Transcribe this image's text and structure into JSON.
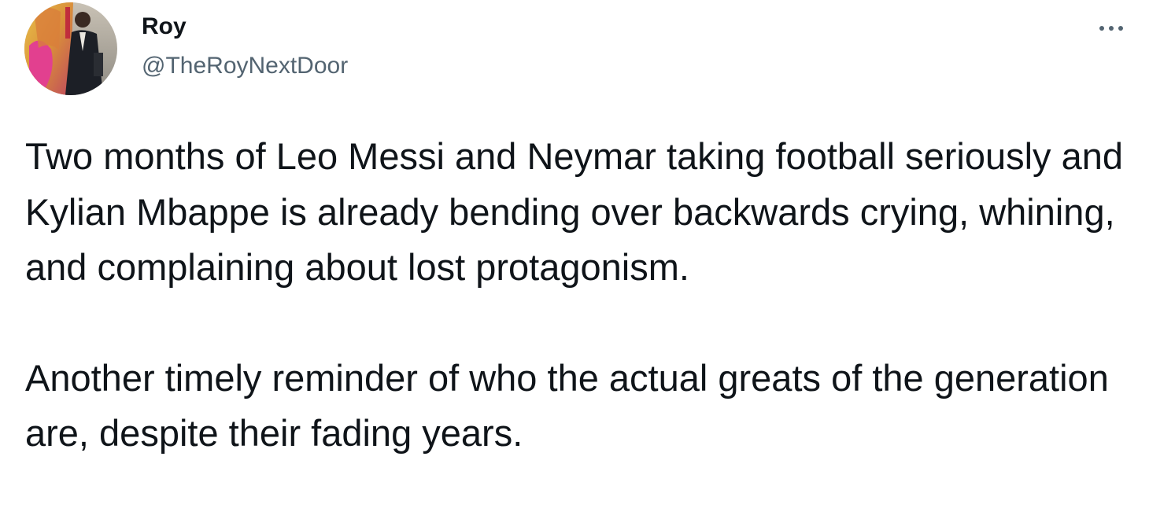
{
  "tweet": {
    "author": {
      "display_name": "Roy",
      "handle": "@TheRoyNextDoor",
      "avatar_icon": "profile-photo-avatar"
    },
    "more_icon": "more-horizontal-icon",
    "paragraphs": [
      "Two months of Leo Messi and Neymar taking football seriously and Kylian Mbappe is already bending over backwards crying, whining, and complaining about lost protagonism.",
      "Another timely reminder of who the actual greats of the generation are, despite their fading years."
    ]
  },
  "colors": {
    "text_primary": "#0f1419",
    "text_secondary": "#536471",
    "background": "#ffffff"
  }
}
